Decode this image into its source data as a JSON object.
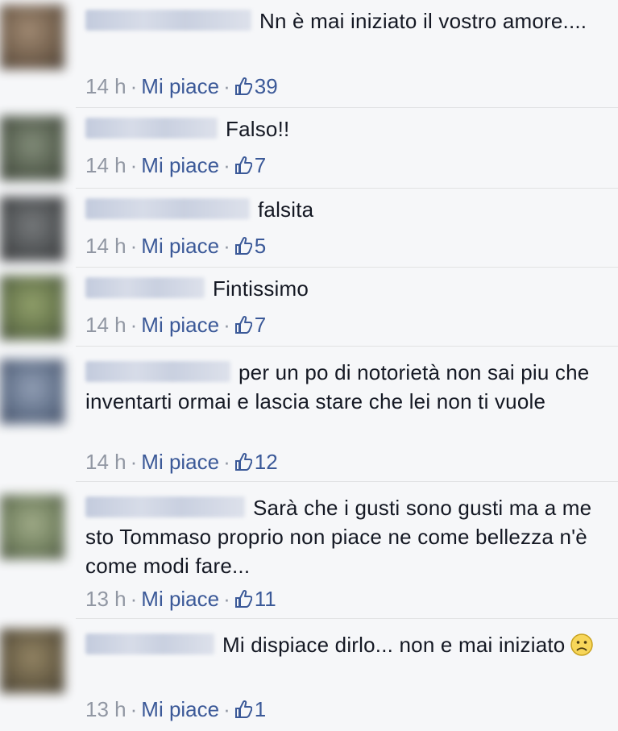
{
  "ui": {
    "like_label": "Mi piace",
    "separator": "·",
    "author_names": "blurred",
    "thumb_icon": "thumb-up-icon",
    "emoji_icon": "sad-face-icon"
  },
  "comments": [
    {
      "text": "Nn è mai iniziato il vostro amore....",
      "time": "14 h",
      "likes": "39",
      "avatar_color": "#6a5540"
    },
    {
      "text": "Falso!!",
      "time": "14 h",
      "likes": "7",
      "avatar_color": "#4d5745"
    },
    {
      "text": "falsita",
      "time": "14 h",
      "likes": "5",
      "avatar_color": "#45484a"
    },
    {
      "text": "Fintissimo",
      "time": "14 h",
      "likes": "7",
      "avatar_color": "#5e6e40"
    },
    {
      "text": "per un po di notorietà non sai piu che inventarti ormai e lascia stare che lei non ti vuole",
      "time": "14 h",
      "likes": "12",
      "avatar_color": "#5a6a84"
    },
    {
      "text": "Sarà che i gusti sono gusti ma a me sto Tommaso proprio non piace ne come bellezza n'è come modi fare...",
      "time": "13 h",
      "likes": "11",
      "avatar_color": "#6b7a56"
    },
    {
      "text": "Mi dispiace dirlo... non e mai iniziato",
      "time": "13 h",
      "likes": "1",
      "avatar_color": "#5e5238"
    }
  ]
}
